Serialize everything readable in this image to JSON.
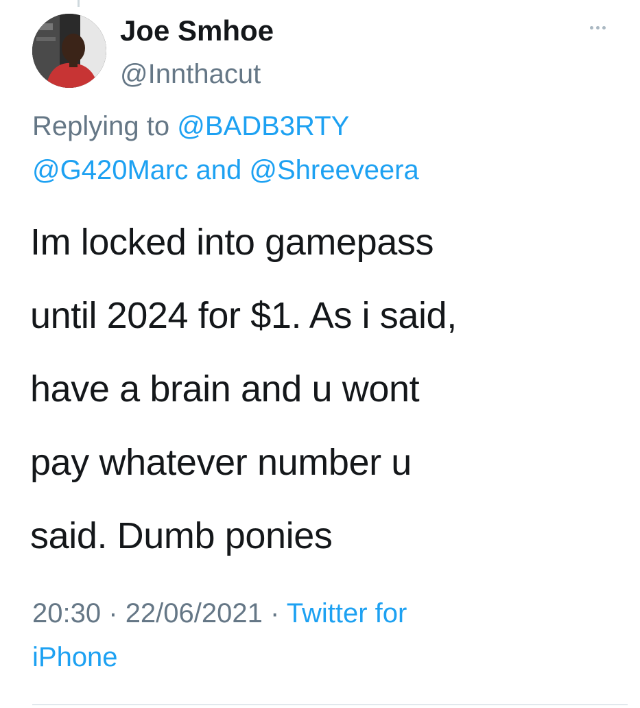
{
  "tweet": {
    "author": {
      "display_name": "Joe Smhoe",
      "handle": "@Innthacut"
    },
    "reply": {
      "prefix": "Replying to",
      "mentions": [
        "@BADB3RTY",
        "@G420Marc",
        "@Shreeveera"
      ],
      "joiner": "and"
    },
    "text_lines": [
      "Im locked into gamepass",
      "until 2024 for $1. As i said,",
      "have a brain and u wont",
      "pay whatever number u",
      "said. Dumb ponies"
    ],
    "time": "20:30",
    "date": "22/06/2021",
    "separator": "·",
    "source_line1": "Twitter for",
    "source_line2": "iPhone"
  },
  "icons": {
    "more": "more-horizontal-icon"
  },
  "colors": {
    "text": "#14171a",
    "secondary": "#657786",
    "link": "#1da1f2",
    "divider": "#e1e8ed"
  }
}
